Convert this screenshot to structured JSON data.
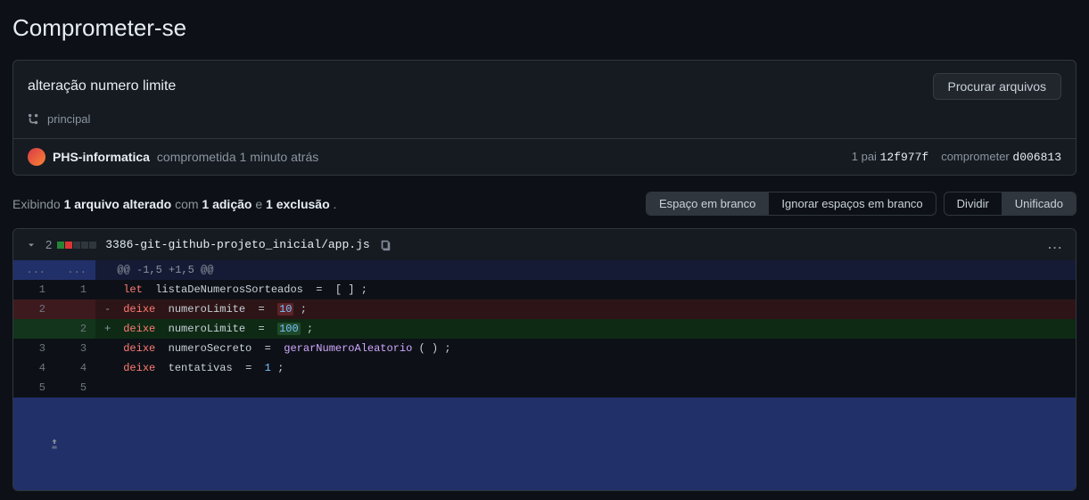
{
  "page": {
    "title": "Comprometer-se"
  },
  "commit": {
    "message": "alteração numero limite",
    "browse_files_label": "Procurar arquivos",
    "branch": "principal",
    "author": "PHS-informatica",
    "committed_text": "comprometida 1 minuto atrás",
    "parent_label": "1 pai",
    "parent_sha": "12f977f",
    "commit_label": "comprometer",
    "commit_sha": "d006813"
  },
  "summary": {
    "showing": "Exibindo",
    "files_changed": "1 arquivo alterado",
    "with": "com",
    "additions": "1 adição",
    "and": "e",
    "deletions": "1 exclusão",
    "period": "."
  },
  "toolbar": {
    "whitespace": {
      "show": "Espaço em branco",
      "ignore": "Ignorar espaços em branco"
    },
    "view": {
      "split": "Dividir",
      "unified": "Unificado"
    }
  },
  "file": {
    "stat_count": "2",
    "path": "3386-git-github-projeto_inicial/app.js"
  },
  "diff": {
    "hunk": "@@ -1,5 +1,5 @@",
    "lines": {
      "l1_old": "1",
      "l1_new": "1",
      "l2_old": "2",
      "l3_new": "2",
      "l4_old": "3",
      "l4_new": "3",
      "l5_old": "4",
      "l5_new": "4",
      "l6_old": "5",
      "l6_new": "5"
    },
    "tokens": {
      "let": "let",
      "deixe": "deixe",
      "listaDeNumerosSorteados": "listaDeNumerosSorteados",
      "numeroLimite": "numeroLimite",
      "numeroSecreto": "numeroSecreto",
      "gerarNumeroAleatorio": "gerarNumeroAleatorio",
      "tentativas": "tentativas",
      "eq": "=",
      "sc": ";",
      "lb": "[",
      "rb": "]",
      "lp": "(",
      "rp": ")",
      "v10": "10",
      "v100": "100",
      "v1": "1",
      "minus": "-",
      "plus": "+"
    }
  },
  "icons": {
    "dots": "..."
  }
}
